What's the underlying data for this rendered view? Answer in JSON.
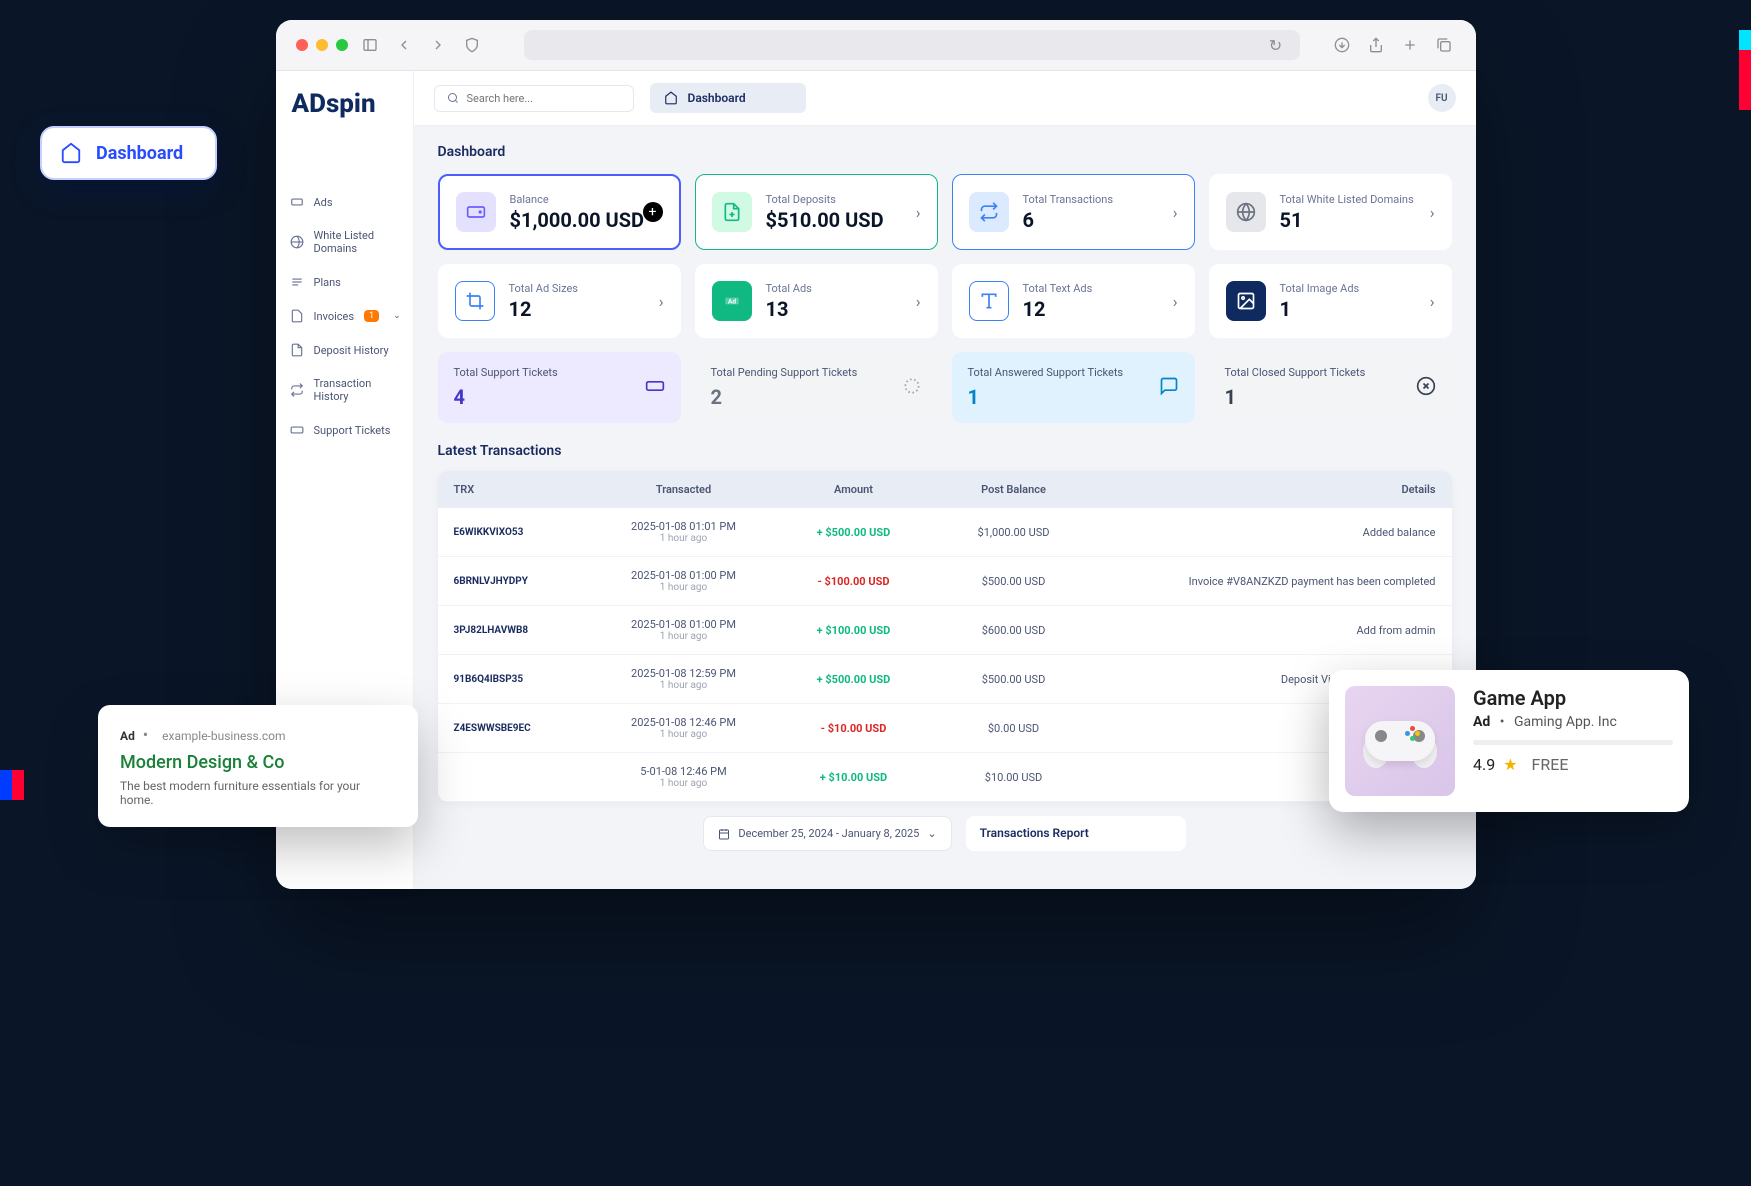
{
  "browser": {
    "reload": "↻"
  },
  "logo": {
    "prefix": "AD",
    "suffix": "spin"
  },
  "dashboard_pill": "Dashboard",
  "search": {
    "placeholder": "Search here..."
  },
  "crumb": {
    "label": "Dashboard"
  },
  "avatar": "FU",
  "page_title": "Dashboard",
  "nav": {
    "items": [
      {
        "label": "Ads"
      },
      {
        "label": "White Listed Domains"
      },
      {
        "label": "Plans"
      },
      {
        "label": "Invoices",
        "badge": "1"
      },
      {
        "label": "Deposit History"
      },
      {
        "label": "Transaction History"
      },
      {
        "label": "Support Tickets"
      }
    ]
  },
  "cards": {
    "balance": {
      "label": "Balance",
      "value": "$1,000.00 USD"
    },
    "deposits": {
      "label": "Total Deposits",
      "value": "$510.00 USD"
    },
    "transactions": {
      "label": "Total Transactions",
      "value": "6"
    },
    "domains": {
      "label": "Total White Listed Domains",
      "value": "51"
    },
    "sizes": {
      "label": "Total Ad Sizes",
      "value": "12"
    },
    "totalads": {
      "label": "Total Ads",
      "value": "13"
    },
    "textads": {
      "label": "Total Text Ads",
      "value": "12"
    },
    "imageads": {
      "label": "Total Image Ads",
      "value": "1"
    }
  },
  "tickets": {
    "total": {
      "label": "Total Support Tickets",
      "value": "4"
    },
    "pending": {
      "label": "Total Pending Support Tickets",
      "value": "2"
    },
    "answered": {
      "label": "Total Answered Support Tickets",
      "value": "1"
    },
    "closed": {
      "label": "Total Closed Support Tickets",
      "value": "1"
    }
  },
  "transactions_section": {
    "title": "Latest Transactions",
    "headers": {
      "trx": "TRX",
      "transacted": "Transacted",
      "amount": "Amount",
      "balance": "Post Balance",
      "details": "Details"
    },
    "rows": [
      {
        "trx": "E6WIKKVIXO53",
        "date": "2025-01-08 01:01 PM",
        "ago": "1 hour ago",
        "amount": "+ $500.00 USD",
        "sign": "plus",
        "balance": "$1,000.00 USD",
        "details": "Added balance"
      },
      {
        "trx": "6BRNLVJHYDPY",
        "date": "2025-01-08 01:00 PM",
        "ago": "1 hour ago",
        "amount": "- $100.00 USD",
        "sign": "minus",
        "balance": "$500.00 USD",
        "details": "Invoice #V8ANZKZD payment has been completed"
      },
      {
        "trx": "3PJ82LHAVWB8",
        "date": "2025-01-08 01:00 PM",
        "ago": "1 hour ago",
        "amount": "+ $100.00 USD",
        "sign": "plus",
        "balance": "$600.00 USD",
        "details": "Add from admin"
      },
      {
        "trx": "91B6Q4IBSP35",
        "date": "2025-01-08 12:59 PM",
        "ago": "1 hour ago",
        "amount": "+ $500.00 USD",
        "sign": "plus",
        "balance": "$500.00 USD",
        "details": "Deposit Via Stripe Hosted - USD"
      },
      {
        "trx": "Z4ESWWSBE9EC",
        "date": "2025-01-08 12:46 PM",
        "ago": "1 hour ago",
        "amount": "- $10.00 USD",
        "sign": "minus",
        "balance": "$0.00 USD",
        "details": ""
      },
      {
        "trx": "",
        "date": "5-01-08 12:46 PM",
        "ago": "1 hour ago",
        "amount": "+ $10.00 USD",
        "sign": "plus",
        "balance": "$10.00 USD",
        "details": ""
      }
    ]
  },
  "date_range": "December 25, 2024 - January 8, 2025",
  "report_title": "Transactions Report",
  "ad1": {
    "tag": "Ad",
    "dot": "•",
    "domain": "example-business.com",
    "title": "Modern Design & Co",
    "desc": "The best modern furniture essentials for your home."
  },
  "ad2": {
    "title": "Game App",
    "tag": "Ad",
    "dot": "•",
    "company": "Gaming App. Inc",
    "rating": "4.9",
    "star": "★",
    "free": "FREE"
  }
}
